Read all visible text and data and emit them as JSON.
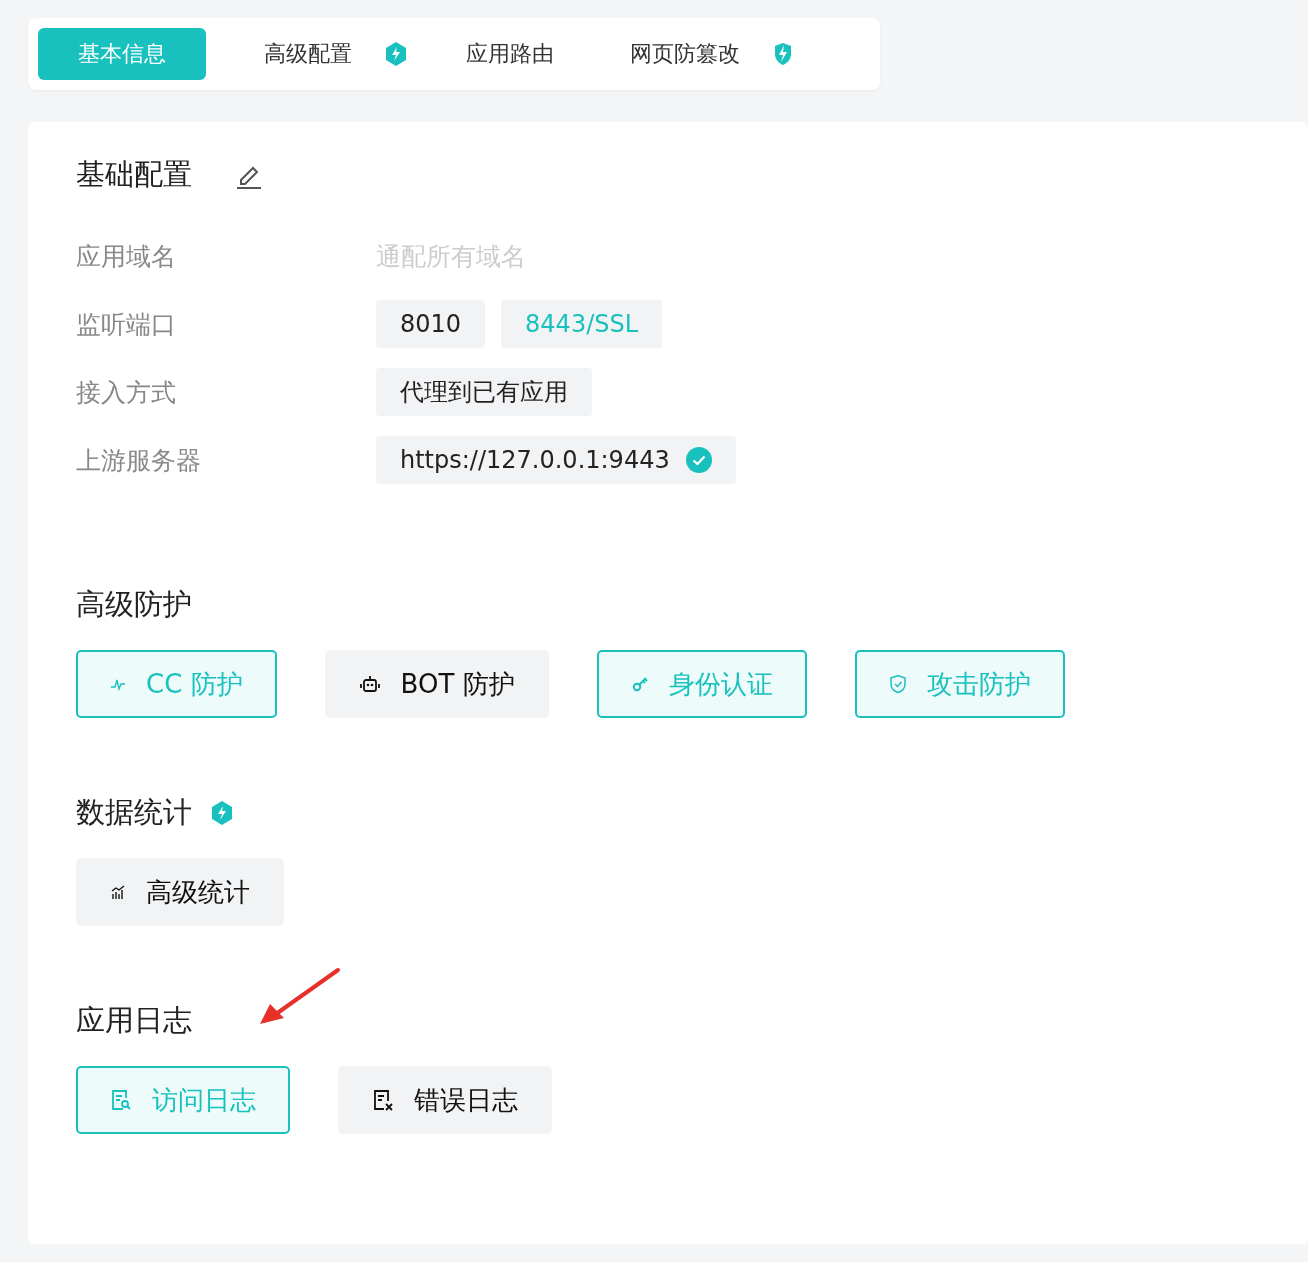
{
  "tabs": [
    {
      "label": "基本信息",
      "selected": true
    },
    {
      "label": "高级配置",
      "selected": false,
      "badge": {
        "kind": "hex"
      }
    },
    {
      "label": "应用路由",
      "selected": false
    },
    {
      "label": "网页防篡改",
      "selected": false,
      "badge": {
        "kind": "shield"
      }
    }
  ],
  "sections": [
    {
      "title": "基础配置",
      "kind": "fields",
      "action": {
        "kind": "edit"
      },
      "fields": [
        {
          "label": "应用域名",
          "values": [
            {
              "text": "通配所有域名",
              "kind": "placeholder"
            }
          ]
        },
        {
          "label": "监听端口",
          "values": [
            {
              "text": "8010",
              "kind": "chip",
              "highlighted": false
            },
            {
              "text": "8443/SSL",
              "kind": "chip",
              "highlighted": true
            }
          ]
        },
        {
          "label": "接入方式",
          "values": [
            {
              "text": "代理到已有应用",
              "kind": "chip",
              "highlighted": false
            }
          ]
        },
        {
          "label": "上游服务器",
          "values": [
            {
              "text": "https://127.0.0.1:9443",
              "kind": "chip",
              "highlighted": false,
              "verified": true
            }
          ]
        }
      ]
    },
    {
      "title": "高级防护",
      "kind": "buttons",
      "buttons": [
        {
          "label": "CC 防护",
          "kind": "pulse",
          "on": true
        },
        {
          "label": "BOT 防护",
          "kind": "robot",
          "on": false
        },
        {
          "label": "身份认证",
          "kind": "key",
          "on": true
        },
        {
          "label": "攻击防护",
          "kind": "shield",
          "on": true
        }
      ]
    },
    {
      "title": "数据统计",
      "kind": "buttons",
      "badge": {
        "kind": "hex"
      },
      "buttons": [
        {
          "label": "高级统计",
          "kind": "chart",
          "on": false
        }
      ]
    },
    {
      "title": "应用日志",
      "kind": "buttons",
      "pointer": true,
      "buttons": [
        {
          "label": "访问日志",
          "kind": "log-search",
          "on": true
        },
        {
          "label": "错误日志",
          "kind": "log-x",
          "on": false
        }
      ]
    }
  ]
}
